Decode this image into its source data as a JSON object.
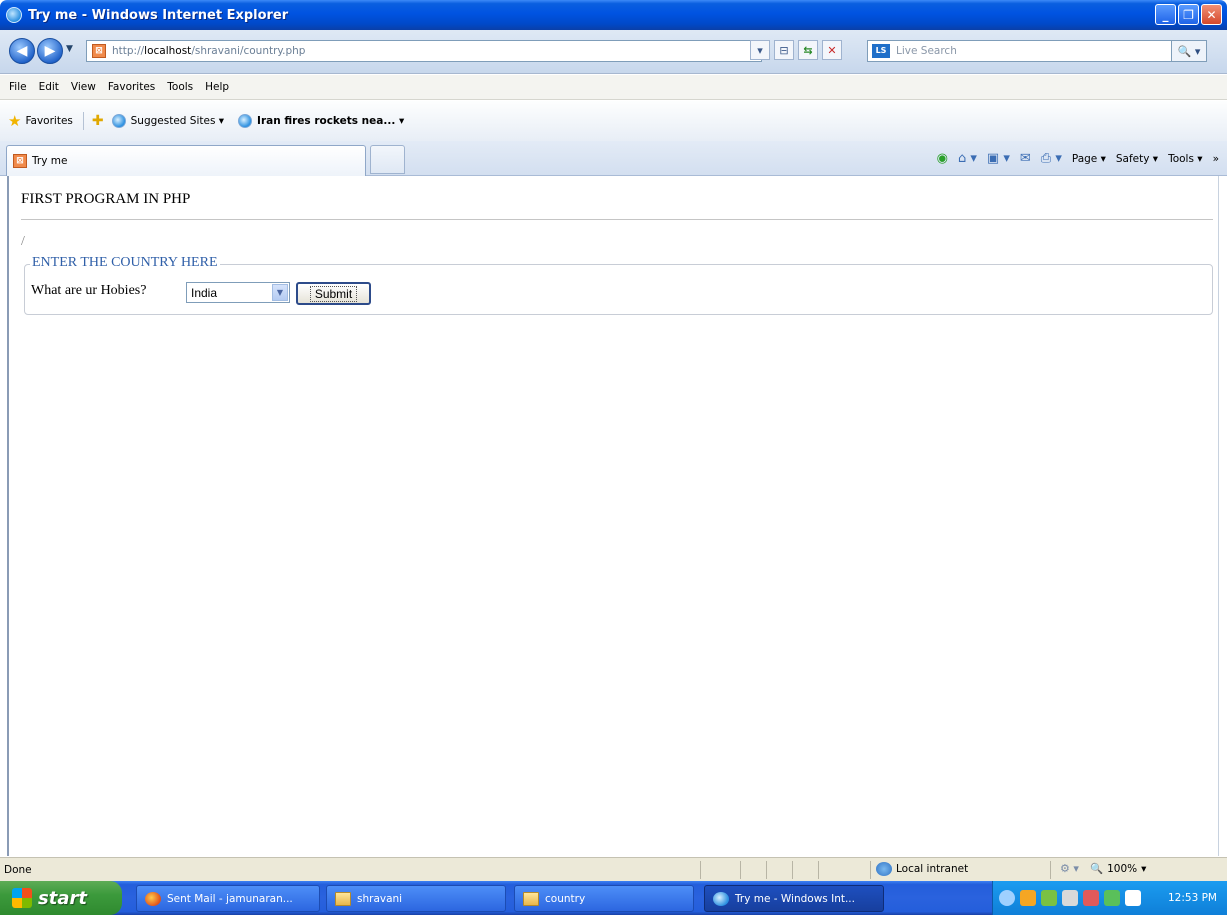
{
  "window": {
    "title": "Try me - Windows Internet Explorer"
  },
  "address_bar": {
    "url_prefix": "http://",
    "url_host": "localhost",
    "url_path": "/shravani/country.php",
    "search_placeholder": "Live Search"
  },
  "menu": {
    "items": [
      "File",
      "Edit",
      "View",
      "Favorites",
      "Tools",
      "Help"
    ]
  },
  "favorites_bar": {
    "favorites_label": "Favorites",
    "links": [
      "Suggested Sites ▾",
      "Iran fires rockets nea... ▾"
    ]
  },
  "tab": {
    "label": "Try me"
  },
  "command_bar": {
    "page_label": "Page ▾",
    "safety_label": "Safety ▾",
    "tools_label": "Tools ▾"
  },
  "page": {
    "heading": "FIRST PROGRAM IN PHP",
    "slash": "/",
    "legend": "ENTER THE COUNTRY HERE",
    "field_label": "What are ur Hobies?",
    "select_value": "India",
    "submit_label": "Submit"
  },
  "status_bar": {
    "status": "Done",
    "zone": "Local intranet",
    "zoom": "100%"
  },
  "taskbar": {
    "start_label": "start",
    "tasks": [
      "Sent Mail - jamunaran...",
      "shravani",
      "country",
      "Try me - Windows Int..."
    ],
    "clock": "12:53 PM"
  }
}
